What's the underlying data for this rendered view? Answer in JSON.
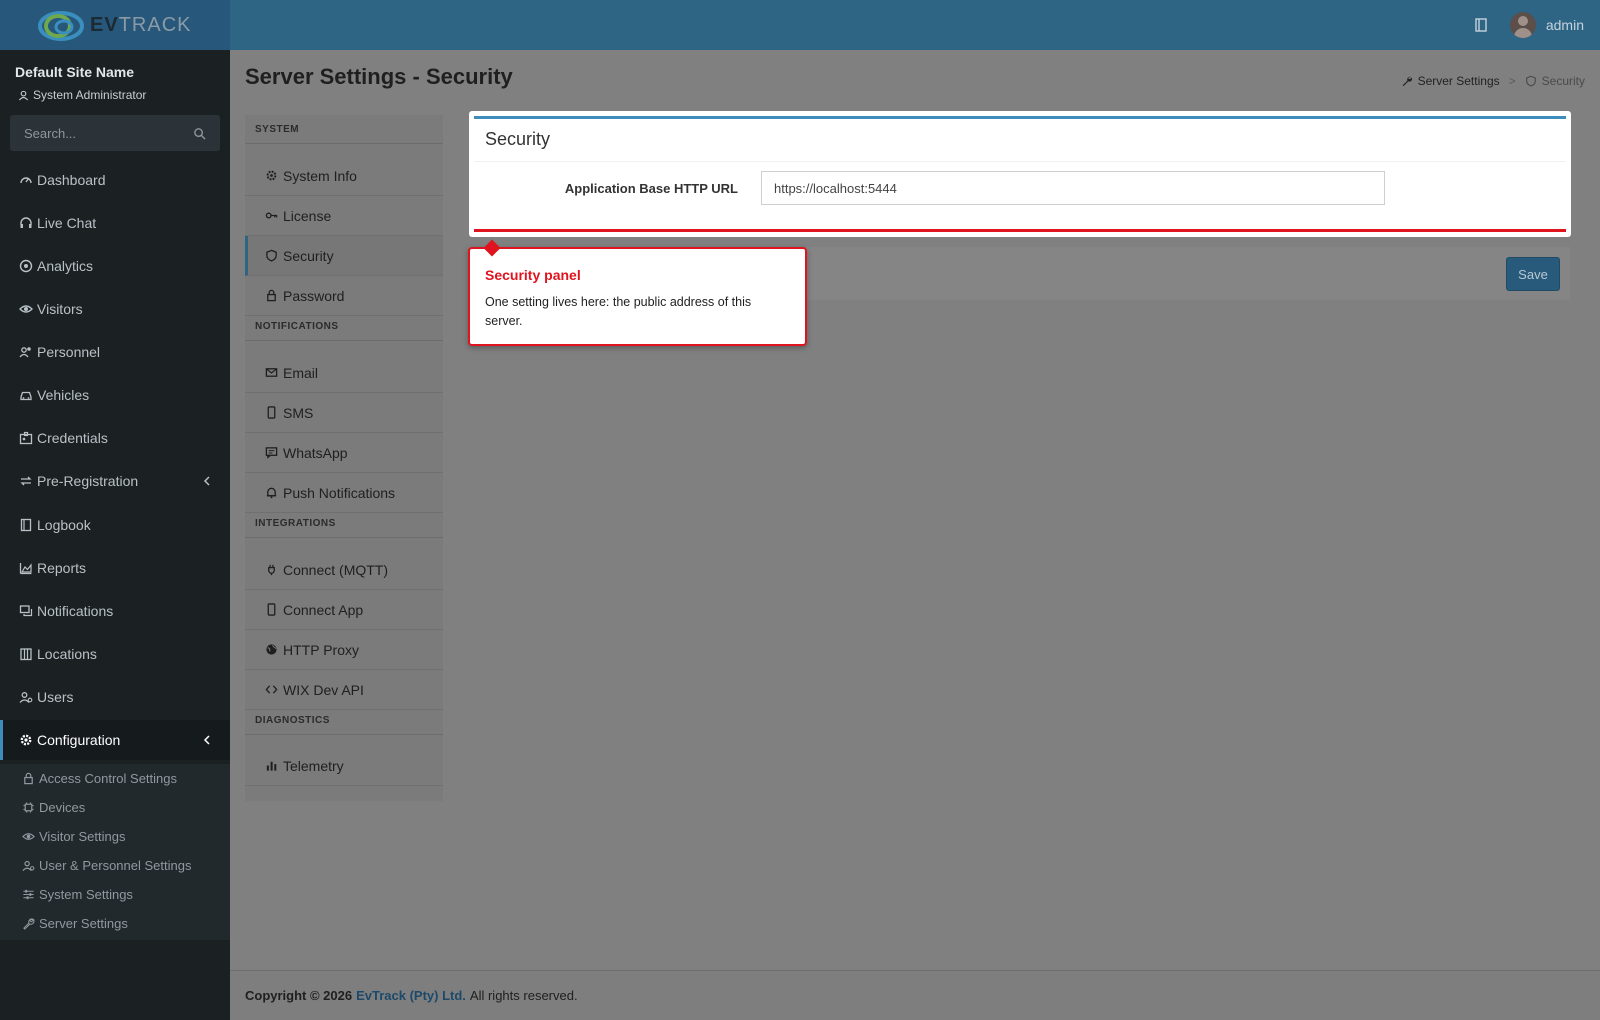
{
  "header": {
    "logo_text_bold": "EV",
    "logo_text_light": "TRACK",
    "username": "admin"
  },
  "sidebar": {
    "site_name": "Default Site Name",
    "role": "System Administrator",
    "search_placeholder": "Search...",
    "items": [
      {
        "label": "Dashboard",
        "icon": "gauge-icon"
      },
      {
        "label": "Live Chat",
        "icon": "headset-icon"
      },
      {
        "label": "Analytics",
        "icon": "target-icon"
      },
      {
        "label": "Visitors",
        "icon": "eye-icon"
      },
      {
        "label": "Personnel",
        "icon": "people-icon"
      },
      {
        "label": "Vehicles",
        "icon": "car-icon"
      },
      {
        "label": "Credentials",
        "icon": "badge-icon"
      },
      {
        "label": "Pre-Registration",
        "icon": "arrows-icon"
      },
      {
        "label": "Logbook",
        "icon": "book-icon"
      },
      {
        "label": "Reports",
        "icon": "chart-area-icon"
      },
      {
        "label": "Notifications",
        "icon": "chat-icon"
      },
      {
        "label": "Locations",
        "icon": "building-icon"
      },
      {
        "label": "Users",
        "icon": "users-icon"
      },
      {
        "label": "Configuration",
        "icon": "gear-icon"
      }
    ],
    "submenu": [
      {
        "label": "Access Control Settings",
        "icon": "lock-icon"
      },
      {
        "label": "Devices",
        "icon": "cpu-icon"
      },
      {
        "label": "Visitor Settings",
        "icon": "eye-icon"
      },
      {
        "label": "User & Personnel Settings",
        "icon": "users-icon"
      },
      {
        "label": "System Settings",
        "icon": "sliders-icon"
      },
      {
        "label": "Server Settings",
        "icon": "wrench-icon"
      }
    ]
  },
  "page": {
    "title": "Server Settings - Security",
    "breadcrumb": [
      "Server Settings",
      "Security"
    ]
  },
  "settings_nav": {
    "sections": [
      {
        "header": "SYSTEM",
        "items": [
          "System Info",
          "License",
          "Security",
          "Password"
        ]
      },
      {
        "header": "NOTIFICATIONS",
        "items": [
          "Email",
          "SMS",
          "WhatsApp",
          "Push Notifications"
        ]
      },
      {
        "header": "INTEGRATIONS",
        "items": [
          "Connect (MQTT)",
          "Connect App",
          "HTTP Proxy",
          "WIX Dev API"
        ]
      },
      {
        "header": "DIAGNOSTICS",
        "items": [
          "Telemetry"
        ]
      }
    ],
    "active": "Security"
  },
  "security_panel": {
    "title": "Security",
    "url_label": "Application Base HTTP URL",
    "url_value": "https://localhost:5444",
    "save_label": "Save"
  },
  "callout": {
    "title": "Security panel",
    "text": "One setting lives here: the public address of this server."
  },
  "footer": {
    "copyright": "Copyright © 2026",
    "company": "EvTrack (Pty) Ltd.",
    "rights": "All rights reserved."
  },
  "colors": {
    "header": "#2e6484",
    "sidebar": "#1b2023",
    "accent": "#3c8dbc",
    "highlight": "#e0141e"
  }
}
